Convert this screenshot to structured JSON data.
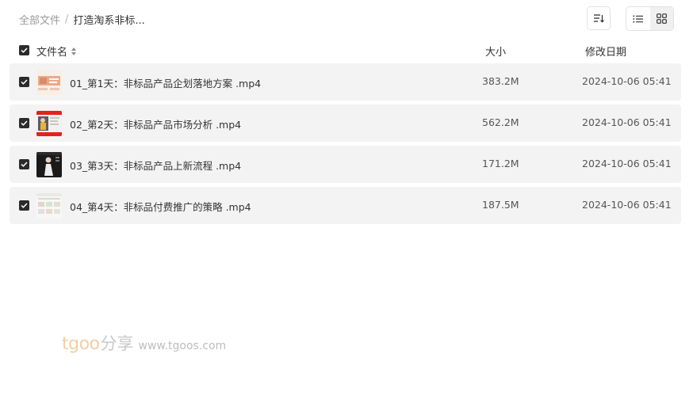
{
  "breadcrumb": {
    "root": "全部文件",
    "separator": "/",
    "current": "打造淘系非标..."
  },
  "toolbar": {
    "sort_icon": "sort-icon",
    "list_view_icon": "list-view-icon",
    "grid_view_icon": "grid-view-icon"
  },
  "header": {
    "name": "文件名",
    "size": "大小",
    "date": "修改日期",
    "all_checked": true
  },
  "files": [
    {
      "name": "01_第1天：非标品产品企划落地方案 .mp4",
      "size": "383.2M",
      "date": "2024-10-06 05:41",
      "checked": true
    },
    {
      "name": "02_第2天：非标品产品市场分析 .mp4",
      "size": "562.2M",
      "date": "2024-10-06 05:41",
      "checked": true
    },
    {
      "name": "03_第3天：非标品产品上新流程 .mp4",
      "size": "171.2M",
      "date": "2024-10-06 05:41",
      "checked": true
    },
    {
      "name": "04_第4天：非标品付费推广的策略 .mp4",
      "size": "187.5M",
      "date": "2024-10-06 05:41",
      "checked": true
    }
  ],
  "watermark": {
    "brand": "tgoo",
    "share": "分享",
    "url": "www.tgoos.com"
  },
  "colors": {
    "row_background": "#f3f3f3",
    "checkbox": "#2b2b2b",
    "watermark_brand": "#f1cfa4"
  }
}
